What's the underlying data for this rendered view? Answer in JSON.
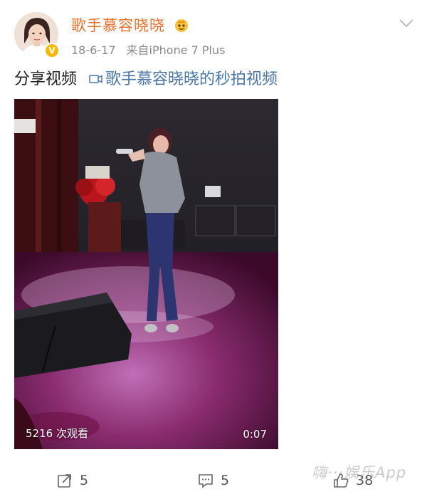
{
  "post": {
    "username": "歌手慕容晓晓",
    "date": "18-6-17",
    "source": "来自iPhone 7 Plus",
    "text_prefix": "分享视频",
    "text_link": "歌手慕容晓晓的秒拍视频"
  },
  "video": {
    "views": "5216 次观看",
    "duration": "0:07"
  },
  "actions": {
    "forward_count": "5",
    "comment_count": "5",
    "like_count": "38"
  },
  "watermark": "嗨···娱乐App",
  "colors": {
    "username": "#e8712d",
    "link": "#4a76a8",
    "verified_badge": "#f6b800"
  },
  "icons": [
    "verified-badge-icon",
    "crown-emoji-icon",
    "chevron-down-icon",
    "video-link-icon",
    "forward-icon",
    "comment-icon",
    "like-icon"
  ]
}
